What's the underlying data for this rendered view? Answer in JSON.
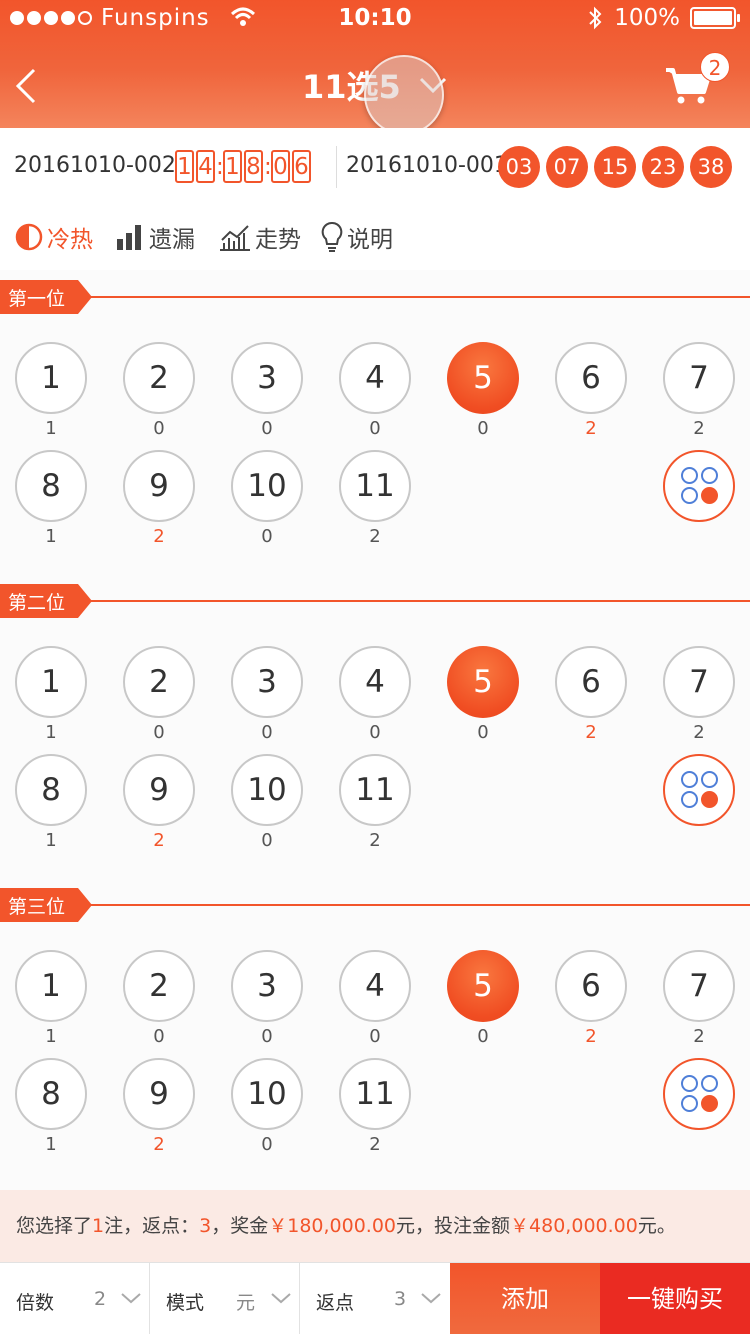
{
  "status_bar": {
    "carrier": "Funspins",
    "time": "10:10",
    "battery": "100%"
  },
  "nav": {
    "title": "11选5",
    "cart_count": "2"
  },
  "draw": {
    "current_issue": "20161010-002",
    "countdown_digits": [
      "1",
      "4",
      "1",
      "8",
      "0",
      "6"
    ],
    "countdown_separator": ":",
    "last_issue": "20161010-001",
    "last_numbers": [
      "03",
      "07",
      "15",
      "23",
      "38"
    ]
  },
  "tools": [
    {
      "label": "冷热",
      "icon": "cold-hot-icon",
      "active": true
    },
    {
      "label": "遗漏",
      "icon": "bar-chart-icon",
      "active": false
    },
    {
      "label": "走势",
      "icon": "trend-icon",
      "active": false
    },
    {
      "label": "说明",
      "icon": "bulb-icon",
      "active": false
    }
  ],
  "positions": [
    {
      "label": "第一位"
    },
    {
      "label": "第二位"
    },
    {
      "label": "第三位"
    }
  ],
  "balls": [
    "1",
    "2",
    "3",
    "4",
    "5",
    "6",
    "7",
    "8",
    "9",
    "10",
    "11"
  ],
  "missing": [
    "1",
    "0",
    "0",
    "0",
    "0",
    "2",
    "2",
    "1",
    "2",
    "0",
    "2"
  ],
  "hot_indices": [
    5,
    8
  ],
  "selected_index": 4,
  "summary": {
    "p1": "您选择了",
    "notes": "1",
    "p2": "注，返点：",
    "rebate": "3",
    "p3": "，奖金",
    "prize": "￥180,000.00",
    "p4": "元，投注金额",
    "amount": "￥480,000.00",
    "p5": "元。"
  },
  "bottom": {
    "multiple_label": "倍数",
    "multiple_value": "2",
    "mode_label": "模式",
    "mode_value": "元",
    "rebate_label": "返点",
    "rebate_value": "3",
    "add_label": "添加",
    "buy_label": "一键购买"
  },
  "colors": {
    "accent": "#f2552b",
    "buy": "#ea2b22",
    "random_blue": "#4f7fd8"
  }
}
